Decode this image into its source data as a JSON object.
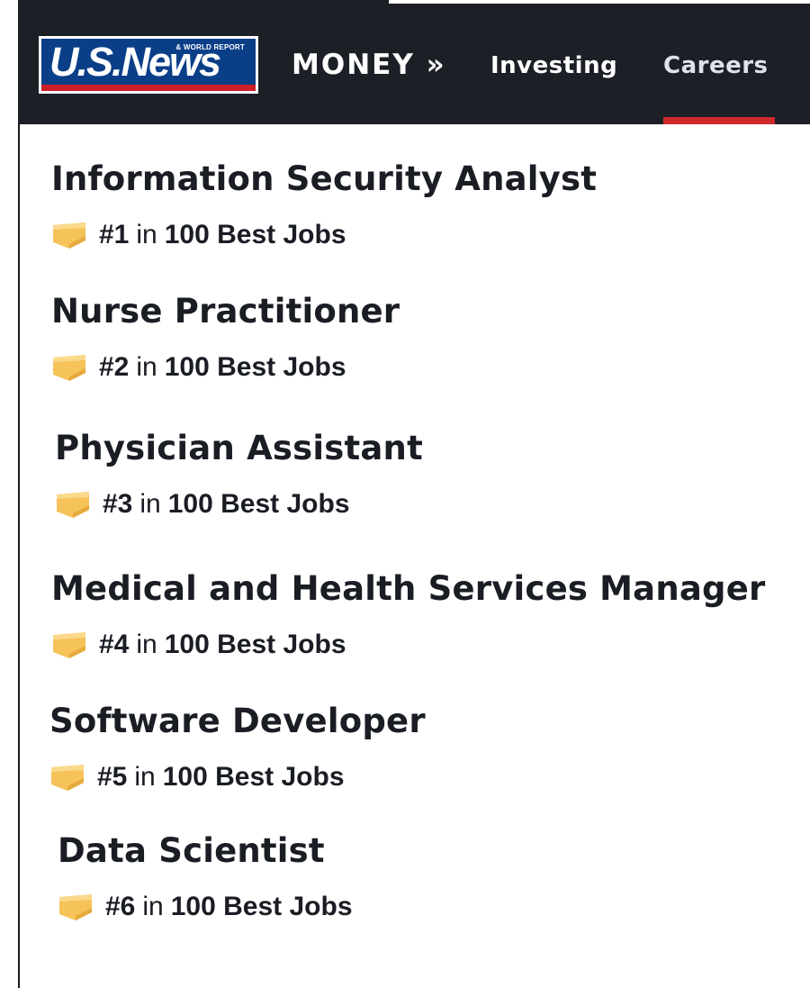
{
  "header": {
    "logo_word": "U.S.News",
    "logo_tagline": "& WORLD REPORT",
    "section": "MONEY »",
    "nav": [
      {
        "label": "Investing"
      },
      {
        "label": "Careers",
        "active": true
      }
    ]
  },
  "jobs": [
    {
      "title": "Information Security Analyst",
      "rank": "#1",
      "connector": "in",
      "list": "100 Best Jobs"
    },
    {
      "title": "Nurse Practitioner",
      "rank": "#2",
      "connector": "in",
      "list": "100 Best Jobs"
    },
    {
      "title": "Physician Assistant",
      "rank": "#3",
      "connector": "in",
      "list": "100 Best Jobs"
    },
    {
      "title": "Medical and Health Services Manager",
      "rank": "#4",
      "connector": "in",
      "list": "100 Best Jobs"
    },
    {
      "title": "Software Developer",
      "rank": "#5",
      "connector": "in",
      "list": "100 Best Jobs"
    },
    {
      "title": "Data Scientist",
      "rank": "#6",
      "connector": "in",
      "list": "100 Best Jobs"
    }
  ],
  "colors": {
    "header_bg": "#1c1f26",
    "active_tab_underline": "#cf2b2b",
    "badge_gold": "#f5c35a",
    "logo_blue": "#0a3f88"
  },
  "icons": {
    "badge": "ribbon-badge-icon"
  }
}
